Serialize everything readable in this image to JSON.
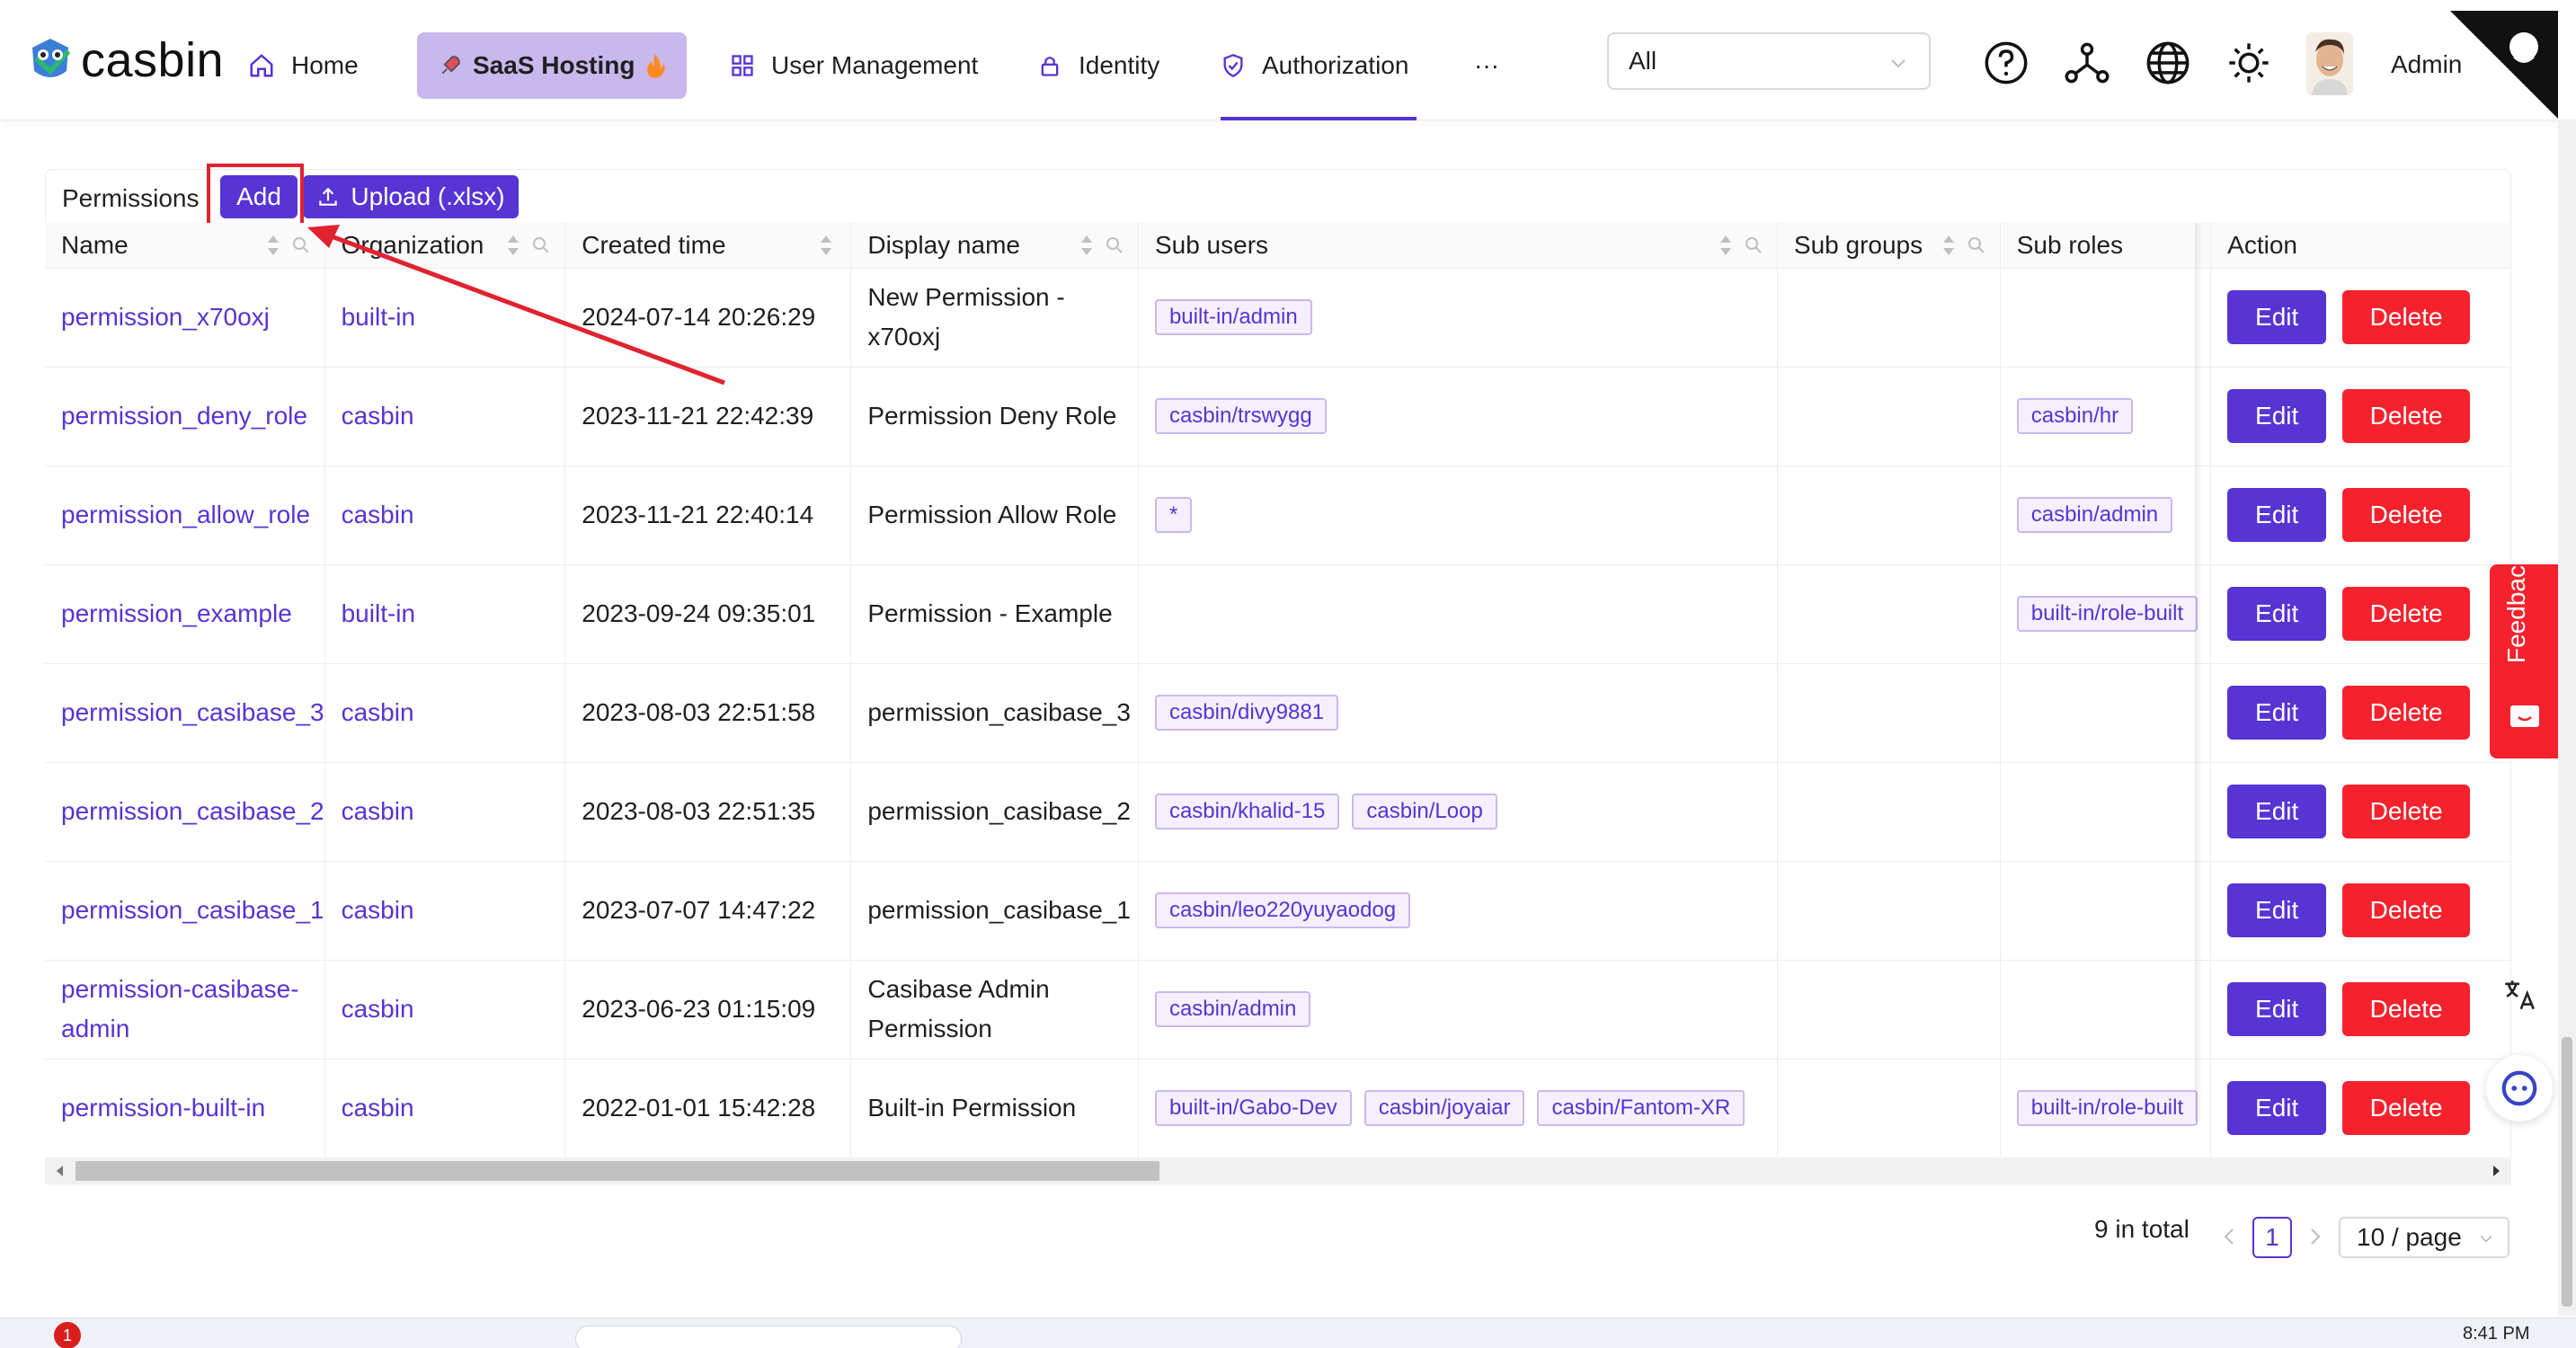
{
  "brand": {
    "name": "casbin"
  },
  "nav": {
    "home": "Home",
    "saas": "SaaS Hosting",
    "user_management": "User Management",
    "identity": "Identity",
    "authorization": "Authorization",
    "more": "···"
  },
  "org_select": {
    "value": "All"
  },
  "user": {
    "name": "Admin"
  },
  "toolbar": {
    "title": "Permissions",
    "add_label": "Add",
    "upload_label": "Upload (.xlsx)"
  },
  "columns": {
    "name": "Name",
    "organization": "Organization",
    "created_time": "Created time",
    "display_name": "Display name",
    "sub_users": "Sub users",
    "sub_groups": "Sub groups",
    "sub_roles": "Sub roles",
    "action": "Action"
  },
  "row_actions": {
    "edit": "Edit",
    "delete": "Delete"
  },
  "rows": [
    {
      "name": "permission_x70oxj",
      "organization": "built-in",
      "created": "2024-07-14 20:26:29",
      "display": "New Permission - x70oxj",
      "sub_users": [
        "built-in/admin"
      ],
      "sub_roles": []
    },
    {
      "name": "permission_deny_role",
      "organization": "casbin",
      "created": "2023-11-21 22:42:39",
      "display": "Permission Deny Role",
      "sub_users": [
        "casbin/trswygg"
      ],
      "sub_roles": [
        "casbin/hr"
      ]
    },
    {
      "name": "permission_allow_role",
      "organization": "casbin",
      "created": "2023-11-21 22:40:14",
      "display": "Permission Allow Role",
      "sub_users": [
        "*"
      ],
      "sub_roles": [
        "casbin/admin"
      ]
    },
    {
      "name": "permission_example",
      "organization": "built-in",
      "created": "2023-09-24 09:35:01",
      "display": "Permission - Example",
      "sub_users": [],
      "sub_roles": [
        "built-in/role-built"
      ]
    },
    {
      "name": "permission_casibase_3",
      "organization": "casbin",
      "created": "2023-08-03 22:51:58",
      "display": "permission_casibase_3",
      "sub_users": [
        "casbin/divy9881"
      ],
      "sub_roles": []
    },
    {
      "name": "permission_casibase_2",
      "organization": "casbin",
      "created": "2023-08-03 22:51:35",
      "display": "permission_casibase_2",
      "sub_users": [
        "casbin/khalid-15",
        "casbin/Loop"
      ],
      "sub_roles": []
    },
    {
      "name": "permission_casibase_1",
      "organization": "casbin",
      "created": "2023-07-07 14:47:22",
      "display": "permission_casibase_1",
      "sub_users": [
        "casbin/leo220yuyaodog"
      ],
      "sub_roles": []
    },
    {
      "name": "permission-casibase-admin",
      "organization": "casbin",
      "created": "2023-06-23 01:15:09",
      "display": "Casibase Admin Permission",
      "sub_users": [
        "casbin/admin"
      ],
      "sub_roles": []
    },
    {
      "name": "permission-built-in",
      "organization": "casbin",
      "created": "2022-01-01 15:42:28",
      "display": "Built-in Permission",
      "sub_users": [
        "built-in/Gabo-Dev",
        "casbin/joyaiar",
        "casbin/Fantom-XR"
      ],
      "sub_roles": [
        "built-in/role-built"
      ]
    }
  ],
  "pagination": {
    "total": "9 in total",
    "current": "1",
    "page_size": "10 / page"
  },
  "feedback": {
    "label": "Feedback"
  },
  "taskbar": {
    "clock": "8:41 PM",
    "badge": "1"
  },
  "colors": {
    "primary": "#5734d3",
    "danger": "#f5222d",
    "tag_border": "#c9b8ee",
    "saas_bg": "#c9b8ee"
  }
}
